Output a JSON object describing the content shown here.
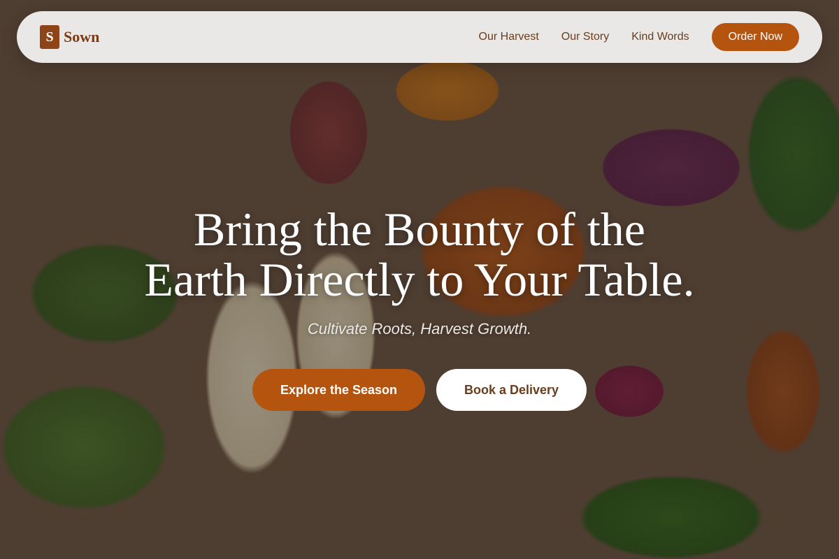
{
  "brand": {
    "mark": "S",
    "name": "Sown"
  },
  "nav": {
    "links": [
      "Our Harvest",
      "Our Story",
      "Kind Words"
    ],
    "cta": "Order Now"
  },
  "hero": {
    "title_line1": "Bring the Bounty of the",
    "title_line2": "Earth Directly to Your Table.",
    "subtitle": "Cultivate Roots, Harvest Growth.",
    "primary_cta": "Explore the Season",
    "secondary_cta": "Book a Delivery"
  },
  "colors": {
    "accent": "#b5540f",
    "brand_text": "#7a3a14",
    "nav_text": "#6a3d1c"
  }
}
